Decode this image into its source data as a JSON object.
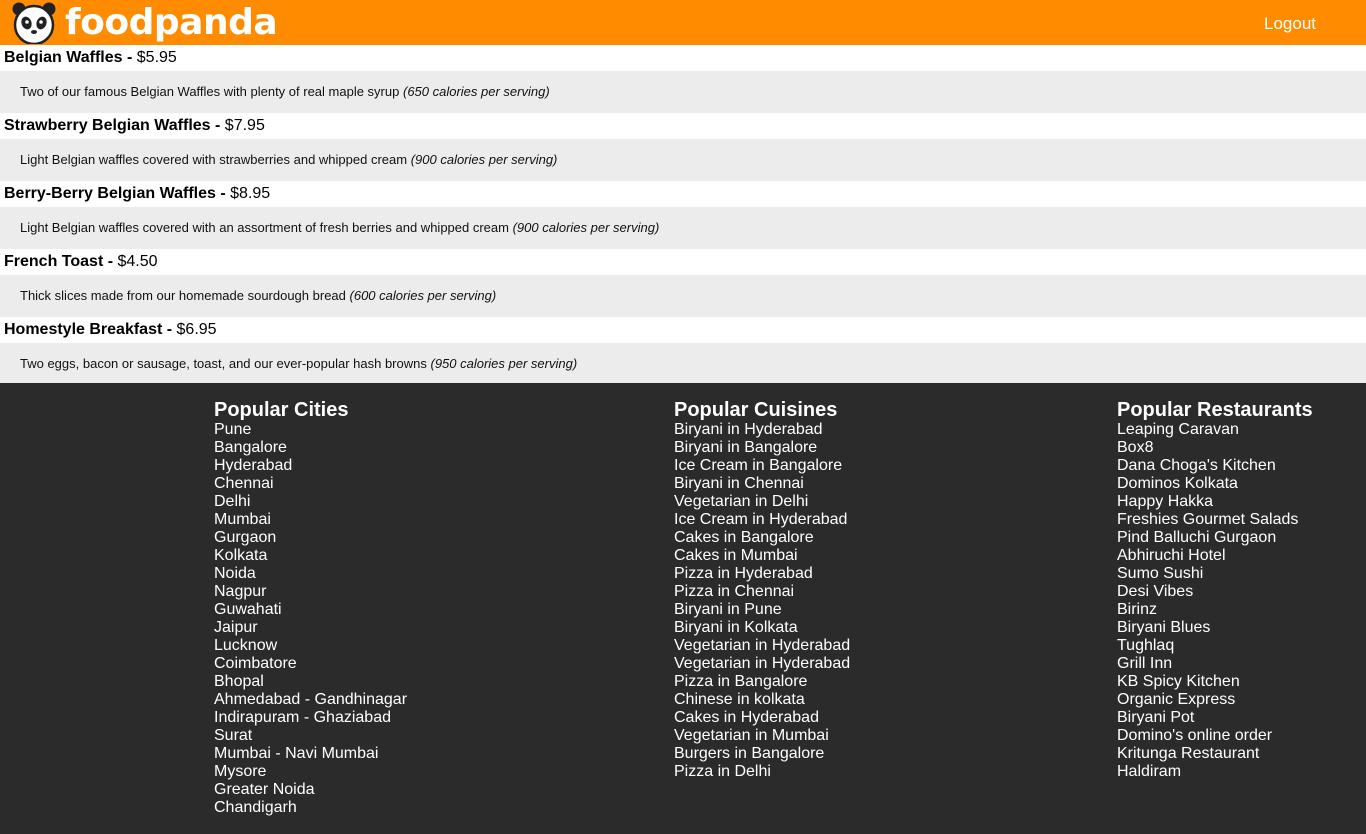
{
  "header": {
    "brand": "foodpanda",
    "logo_icon": "panda-icon",
    "logout_label": "Logout",
    "bg_color": "#ff8c00"
  },
  "menu": [
    {
      "name": "Belgian Waffles",
      "separator": " - ",
      "price": "$5.95",
      "description": "Two of our famous Belgian Waffles with plenty of real maple syrup",
      "calories": "(650 calories per serving)"
    },
    {
      "name": "Strawberry Belgian Waffles",
      "separator": " - ",
      "price": "$7.95",
      "description": "Light Belgian waffles covered with strawberries and whipped cream",
      "calories": "(900 calories per serving)"
    },
    {
      "name": "Berry-Berry Belgian Waffles",
      "separator": " - ",
      "price": "$8.95",
      "description": "Light Belgian waffles covered with an assortment of fresh berries and whipped cream",
      "calories": "(900 calories per serving)"
    },
    {
      "name": "French Toast",
      "separator": " - ",
      "price": "$4.50",
      "description": "Thick slices made from our homemade sourdough bread",
      "calories": "(600 calories per serving)"
    },
    {
      "name": "Homestyle Breakfast",
      "separator": " - ",
      "price": "$6.95",
      "description": "Two eggs, bacon or sausage, toast, and our ever-popular hash browns",
      "calories": "(950 calories per serving)"
    }
  ],
  "footer": {
    "bg_color": "#2b2b2b",
    "cities": {
      "title": "Popular Cities",
      "items": [
        "Pune",
        "Bangalore",
        "Hyderabad",
        "Chennai",
        "Delhi",
        "Mumbai",
        "Gurgaon",
        "Kolkata",
        "Noida",
        "Nagpur",
        "Guwahati",
        "Jaipur",
        "Lucknow",
        "Coimbatore",
        "Bhopal",
        "Ahmedabad - Gandhinagar",
        "Indirapuram - Ghaziabad",
        "Surat",
        "Mumbai - Navi Mumbai",
        "Mysore",
        "Greater Noida",
        "Chandigarh"
      ]
    },
    "cuisines": {
      "title": "Popular Cuisines",
      "items": [
        "Biryani in Hyderabad",
        "Biryani in Bangalore",
        "Ice Cream in Bangalore",
        "Biryani in Chennai",
        "Vegetarian in Delhi",
        "Ice Cream in Hyderabad",
        "Cakes in Bangalore",
        "Cakes in Mumbai",
        "Pizza in Hyderabad",
        "Pizza in Chennai",
        "Biryani in Pune",
        "Biryani in Kolkata",
        "Vegetarian in Hyderabad",
        "Vegetarian in Hyderabad",
        "Pizza in Bangalore",
        "Chinese in kolkata",
        "Cakes in Hyderabad",
        "Vegetarian in Mumbai",
        "Burgers in Bangalore",
        "Pizza in Delhi"
      ]
    },
    "restaurants": {
      "title": "Popular Restaurants",
      "items": [
        "Leaping Caravan",
        "Box8",
        "Dana Choga's Kitchen",
        "Dominos Kolkata",
        "Happy Hakka",
        "Freshies Gourmet Salads",
        "Pind Balluchi Gurgaon",
        "Abhiruchi Hotel",
        "Sumo Sushi",
        "Desi Vibes",
        "Birinz",
        "Biryani Blues",
        "Tughlaq",
        "Grill Inn",
        "KB Spicy Kitchen",
        "Organic Express",
        "Biryani Pot",
        "Domino's online order",
        "Kritunga Restaurant",
        "Haldiram"
      ]
    }
  }
}
